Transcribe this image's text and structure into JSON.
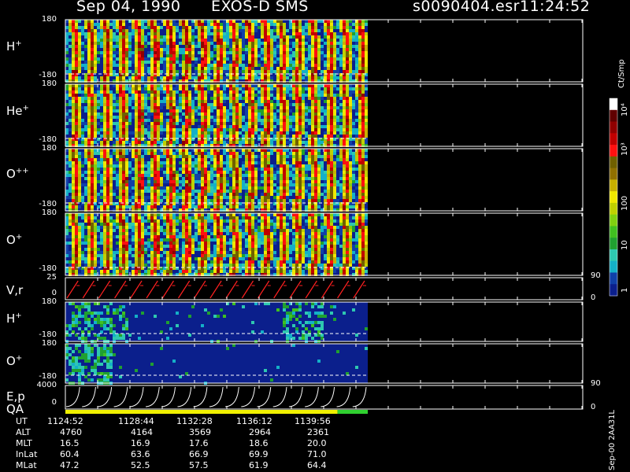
{
  "header": {
    "date": "Sep 04, 1990",
    "instrument": "EXOS-D SMS",
    "file": "s0090404.esr",
    "time": "11:24:52"
  },
  "panels": [
    {
      "label": "H",
      "sup": "+",
      "top_tick": "180",
      "bottom_tick": "-180"
    },
    {
      "label": "He",
      "sup": "+",
      "top_tick": "180",
      "bottom_tick": "-180"
    },
    {
      "label": "O",
      "sup": "++",
      "top_tick": "180",
      "bottom_tick": "-180"
    },
    {
      "label": "O",
      "sup": "+",
      "top_tick": "180",
      "bottom_tick": "-180"
    },
    {
      "label": "V,r",
      "sup": "",
      "top_tick": "25",
      "bottom_tick": "0",
      "right_top": "90",
      "right_bottom": "0"
    },
    {
      "label": "H",
      "sup": "+",
      "top_tick": "180",
      "bottom_tick": "-180"
    },
    {
      "label": "O",
      "sup": "+",
      "top_tick": "180",
      "bottom_tick": "-180"
    },
    {
      "label": "E,p",
      "sup": "",
      "top_tick": "4000",
      "bottom_tick": "0",
      "right_top": "90",
      "right_bottom": "0"
    }
  ],
  "qa_label": "QA",
  "colorbar": {
    "title": "Ct/Smp",
    "ticks": [
      "1",
      "10",
      "100",
      "10³",
      "10⁴"
    ],
    "colors": [
      "#0b1f8c",
      "#1040a8",
      "#14b0c8",
      "#2ec8b0",
      "#20a030",
      "#40c020",
      "#80d010",
      "#c0d000",
      "#f0e800",
      "#c8b000",
      "#907000",
      "#706000",
      "#ff1010",
      "#c00000",
      "#900000",
      "#600000",
      "#ffffff"
    ]
  },
  "side_label": "Sep-00 2AA31L",
  "ephemeris": {
    "labels": [
      "UT",
      "ALT",
      "MLT",
      "InLat",
      "MLat"
    ],
    "columns": [
      [
        "1124:52",
        "4760",
        "16.5",
        "60.4",
        "47.2"
      ],
      [
        "1128:44",
        "4164",
        "16.9",
        "63.6",
        "52.5"
      ],
      [
        "1132:28",
        "3569",
        "17.6",
        "66.9",
        "57.5"
      ],
      [
        "1136:12",
        "2964",
        "18.6",
        "69.9",
        "61.9"
      ],
      [
        "1139:56",
        "2361",
        "20.0",
        "71.0",
        "64.4"
      ]
    ]
  },
  "chart_data": {
    "type": "heatmap",
    "title": "Sep 04, 1990   EXOS-D SMS",
    "x_ticks": [
      "1124:52",
      "1128:44",
      "1132:28",
      "1136:12",
      "1139:56"
    ],
    "y_range_pitch_angle": [
      -180,
      180
    ],
    "colorbar_range": [
      1,
      10000
    ],
    "colorbar_scale": "log",
    "spin_stripes": 19,
    "qa_segments": [
      {
        "color": "#f0f000",
        "fraction": 0.9
      },
      {
        "color": "#30d030",
        "fraction": 0.1
      }
    ]
  }
}
